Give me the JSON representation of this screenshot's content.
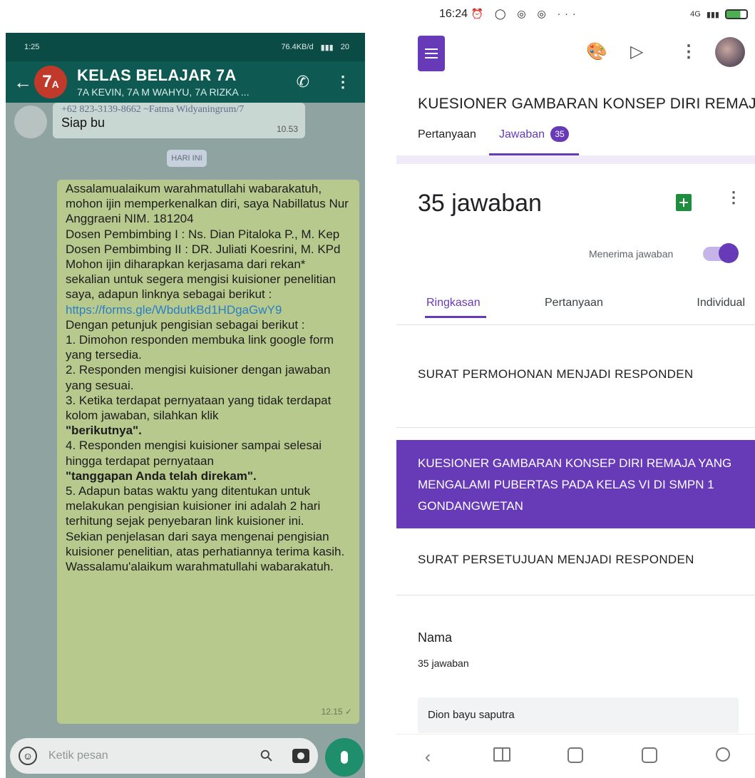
{
  "whatsapp": {
    "status": {
      "time": "1:25",
      "speed": "76.4KB/d",
      "battery": "20"
    },
    "header": {
      "avatar_text": "7",
      "avatar_sub": "A",
      "title": "KELAS BELAJAR 7A",
      "subtitle": "7A KEVIN, 7A M WAHYU, 7A RIZKA ..."
    },
    "prev_message": {
      "sender": "+62 823-3139-8662  ~Fatma Widyaningrum/7",
      "text": "Siap bu",
      "time": "10.53"
    },
    "day_divider": "HARI INI",
    "message": {
      "lines": [
        "Assalamualaikum warahmatullahi wabarakatuh, mohon ijin memperkenalkan diri, saya Nabillatus Nur Anggraeni NIM. 181204",
        "Dosen Pembimbing I : Ns. Dian Pitaloka P., M. Kep",
        "Dosen Pembimbing II : DR. Juliati Koesrini, M. KPd",
        "Mohon ijin diharapkan kerjasama dari rekan* sekalian untuk segera mengisi kuisioner penelitian saya, adapun linknya sebagai berikut :",
        "Dengan petunjuk pengisian sebagai berikut :",
        "1. Dimohon responden membuka link google form yang tersedia.",
        "2. Responden mengisi kuisioner dengan jawaban yang sesuai.",
        "3. Ketika terdapat pernyataan yang tidak terdapat kolom jawaban, silahkan klik",
        "4. Responden mengisi kuisioner sampai selesai hingga terdapat pernyataan",
        "5. Adapun batas waktu yang ditentukan untuk melakukan pengisian kuisioner ini adalah 2 hari terhitung sejak penyebaran link kuisioner ini.",
        "Sekian penjelasan dari saya mengenai pengisian kuisioner penelitian, atas perhatiannya terima kasih.",
        "Wassalamu'alaikum warahmatullahi wabarakatuh."
      ],
      "link": "https://forms.gle/WbdutkBd1HDgaGwY9",
      "bold_next": "\"berikutnya\".",
      "bold_recorded": "\"tanggapan Anda telah direkam\".",
      "time": "12.15 ✓"
    },
    "input": {
      "placeholder": "Ketik pesan"
    }
  },
  "forms": {
    "status": {
      "time": "16:24",
      "icons": "⏰ ◯ ◎ ◎ ···",
      "signal": "4G",
      "battery": "60"
    },
    "form_title": "KUESIONER GAMBARAN KONSEP DIRI REMAJA YANG MENGALAMI PUBERTAS PADA KELAS VI DI SMPN 1 GONDANGWETAN",
    "tabs": {
      "questions": "Pertanyaan",
      "responses": "Jawaban",
      "responses_count": "35"
    },
    "responses": {
      "count_label": "35 jawaban",
      "accepting_label": "Menerima jawaban",
      "accepting": true,
      "sub_tabs": [
        "Ringkasan",
        "Pertanyaan",
        "Individual"
      ]
    },
    "sections": {
      "s1": "SURAT PERMOHONAN MENJADI RESPONDEN",
      "s2": "KUESIONER GAMBARAN KONSEP DIRI REMAJA YANG MENGALAMI PUBERTAS PADA KELAS VI DI SMPN 1 GONDANGWETAN",
      "s3": "SURAT PERSETUJUAN MENJADI RESPONDEN"
    },
    "question": {
      "title": "Nama",
      "count": "35 jawaban",
      "first_answer": "Dion bayu saputra"
    }
  }
}
